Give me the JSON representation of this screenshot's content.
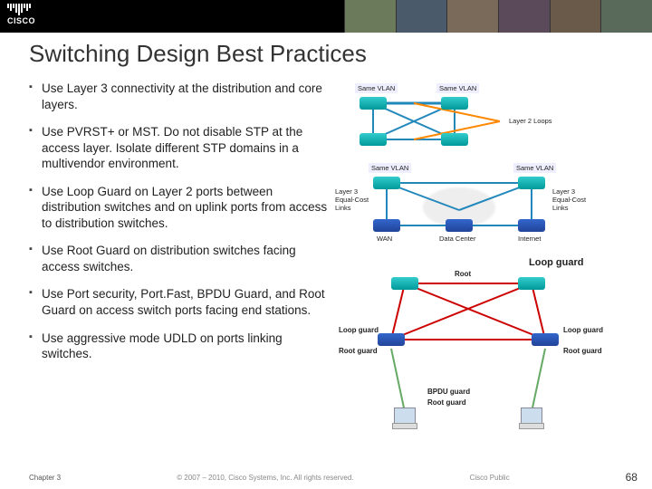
{
  "logo_text": "CISCO",
  "title": "Switching Design Best Practices",
  "bullets": [
    "Use Layer 3 connectivity at the distribution and core layers.",
    "Use PVRST+ or MST. Do not disable STP at the access layer. Isolate different STP domains in a multivendor environment.",
    "Use Loop Guard on Layer 2 ports between distribution switches and on uplink ports from access to distribution switches.",
    "Use Root Guard on distribution switches facing access switches.",
    "Use Port security, Port.Fast, BPDU Guard, and Root Guard on access switch ports facing end stations.",
    "Use aggressive mode UDLD on ports linking switches."
  ],
  "fig1": {
    "top_labels": [
      "Same VLAN",
      "Same VLAN"
    ],
    "right_label": "Layer 2 Loops"
  },
  "fig2": {
    "top_labels": [
      "Same VLAN",
      "Same VLAN"
    ],
    "side_labels": [
      "Layer 3\nEqual-Cost\nLinks",
      "Layer 3\nEqual-Cost\nLinks"
    ],
    "bottom_labels": [
      "WAN",
      "Data Center",
      "Internet"
    ]
  },
  "fig3": {
    "loop_guard": "Loop guard",
    "root": "Root",
    "loop_guard_l": "Loop guard",
    "root_guard_l": "Root guard",
    "loop_guard_r": "Loop guard",
    "root_guard_r": "Root guard",
    "bpdu_guard": "BPDU guard",
    "root_guard_b": "Root guard"
  },
  "footer": {
    "chapter": "Chapter 3",
    "copyright": "© 2007 – 2010, Cisco Systems, Inc. All rights reserved.",
    "public": "Cisco Public",
    "page": "68"
  }
}
